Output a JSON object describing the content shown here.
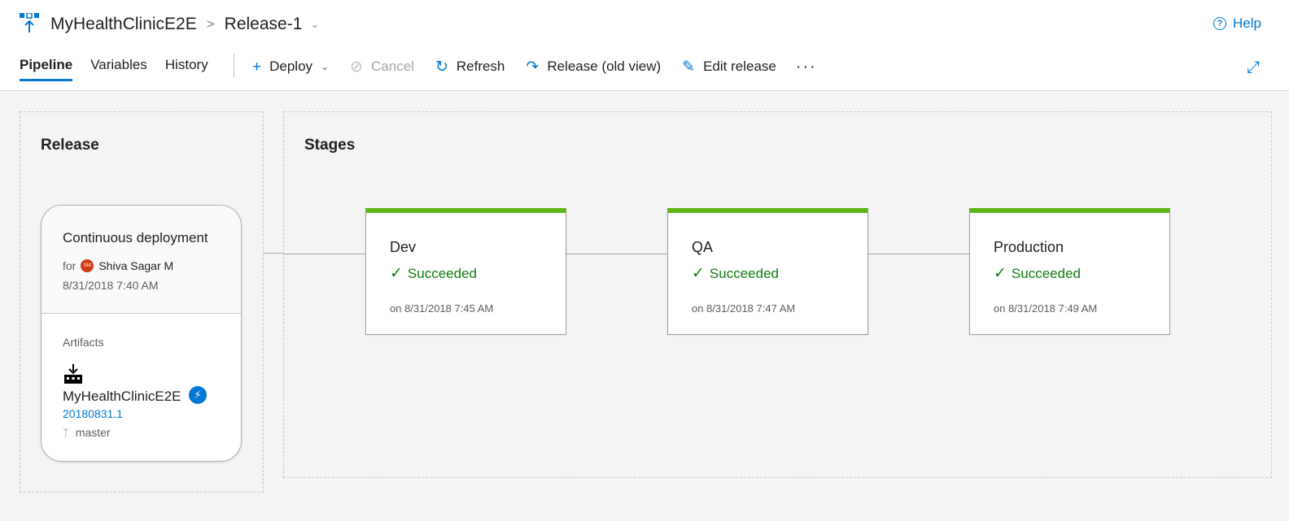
{
  "header": {
    "pipeline_name": "MyHealthClinicE2E",
    "separator": ">",
    "release_name": "Release-1",
    "help_label": "Help"
  },
  "tabs": [
    {
      "label": "Pipeline",
      "active": true
    },
    {
      "label": "Variables",
      "active": false
    },
    {
      "label": "History",
      "active": false
    }
  ],
  "toolbar": {
    "deploy_label": "Deploy",
    "cancel_label": "Cancel",
    "refresh_label": "Refresh",
    "old_view_label": "Release (old view)",
    "edit_label": "Edit release",
    "more_label": "···"
  },
  "release_panel": {
    "title": "Release",
    "trigger": "Continuous deployment",
    "for_label": "for",
    "user_initials": "SM",
    "user_name": "Shiva Sagar M",
    "date": "8/31/2018 7:40 AM",
    "artifacts_label": "Artifacts",
    "artifact": {
      "name": "MyHealthClinicE2E",
      "version": "20180831.1",
      "branch": "master"
    }
  },
  "stages_panel": {
    "title": "Stages",
    "stages": [
      {
        "name": "Dev",
        "status": "Succeeded",
        "time": "on 8/31/2018 7:45 AM"
      },
      {
        "name": "QA",
        "status": "Succeeded",
        "time": "on 8/31/2018 7:47 AM"
      },
      {
        "name": "Production",
        "status": "Succeeded",
        "time": "on 8/31/2018 7:49 AM"
      }
    ]
  },
  "colors": {
    "accent": "#0078d4",
    "success": "#5bb718",
    "success_text": "#107c10",
    "avatar": "#d13b0f"
  },
  "icons": {
    "app": "release-pipeline-icon",
    "help": "help-circle-icon",
    "deploy": "plus-icon",
    "cancel": "cancel-circle-icon",
    "refresh": "refresh-icon",
    "old_view": "share-arrow-icon",
    "edit": "pencil-icon",
    "expand": "expand-diagonal-icon",
    "artifact": "build-artifact-icon",
    "trigger": "lightning-icon",
    "branch": "git-branch-icon",
    "status": "check-icon"
  }
}
